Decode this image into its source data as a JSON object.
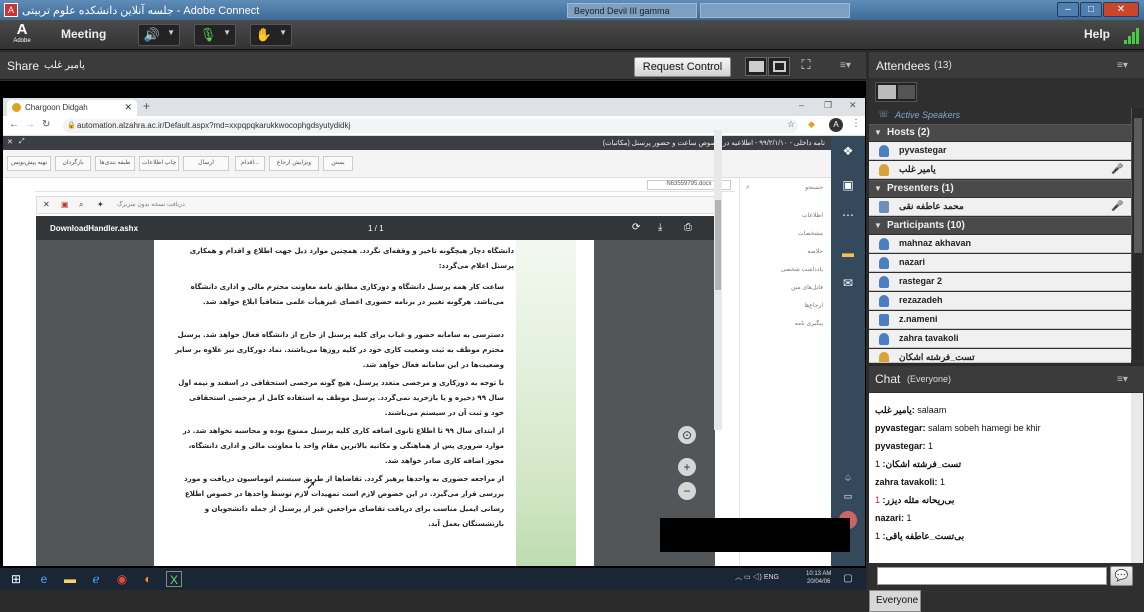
{
  "window": {
    "title": "جلسه آنلاین دانشکده علوم تربیتی - Adobe Connect",
    "app_icon": "adobe-connect-icon",
    "ghost_tab": "Beyond Devil III gamma"
  },
  "menubar": {
    "logo": "Adobe",
    "meeting": "Meeting",
    "help": "Help"
  },
  "share_pod": {
    "title": "Share",
    "presenter": "یامیر غلب",
    "request_control": "Request Control"
  },
  "browser": {
    "tab_title": "Chargoon Didgah",
    "url": "automation.alzahra.ac.ir/Default.aspx?md=xxpqpqkarukkwocophgdsyutydidkj",
    "avatar": "A"
  },
  "webapp": {
    "top_breadcrumb": "نامه داخلی - ۹۹/۲/۱/۱۰ - اطلاعیه در خصوص ساعت و حضور پرسنل (مکاتبات)",
    "toolbar_buttons": [
      "تهیه پیش‌نویس",
      "بازگردان",
      "طبقه بندی‌ها",
      "چاپ اطلاعات",
      "ارسال",
      "اقدام...",
      "ویرایش ارجاع",
      "بستن"
    ],
    "doc_filename": "N63559795.docx",
    "attach_check": "دریافت نسخه بدون سربرگ",
    "search_label": "جستجو",
    "right_nav": [
      "اطلاعات",
      "مشخصات",
      "خلاصه",
      "یادداشت شخصی",
      "فایل‌های متن",
      "ارجاع‌ها",
      "پیگیری نامه"
    ],
    "pdf": {
      "filename": "DownloadHandler.ashx",
      "page_indicator": "1 / 1",
      "intro": "دانشگاه دچار هیچگونه تاخیر و وقفه‌ای نگردد. همچنین موارد ذیل جهت اطلاع و اقدام و همکاری پرسنل اعلام می‌گردد:",
      "bullets": [
        "ساعت کار همه پرسنل دانشگاه و دورکاری مطابق نامه معاونت محترم مالی و اداری دانشگاه می‌باشد. هرگونه تغییر در برنامه حضوری اعضای غیرهیأت علمی متعاقباً ابلاغ خواهد شد.",
        "دسترسی به سامانه حضور و غیاب برای کلیه پرسنل از خارج از دانشگاه فعال خواهد شد. پرسنل محترم موظف به ثبت وضعیت کاری خود در کلیه روزها می‌باشند. نماد دورکاری نیز علاوه بر سایر وضعیت‌ها در این سامانه فعال خواهد شد.",
        "با توجه به دورکاری و مرخصی متعدد پرسنل، هیچ گونه مرخصی استحقاقی در اسفند و نیمه اول سال ۹۹ ذخیره و یا بازخرید نمی‌گردد. پرسنل موظف به استفاده کامل از مرخصی استحقاقی خود و ثبت آن در سیستم می‌باشند.",
        "از ابتدای سال ۹۹ تا اطلاع ثانوی اضافه کاری کلیه پرسنل ممنوع بوده و محاسبه نخواهد شد. در موارد ضروری پس از هماهنگی و مکاتبه بالاترین مقام واحد با معاونت مالی و اداری دانشگاه، مجوز اضافه کاری صادر خواهد شد.",
        "از مراجعه حضوری به واحدها پرهیز گردد. تقاضاها از طریق سیستم اتوماسیون دریافت و مورد بررسی قرار می‌گیرد. در این خصوص لازم است تمهیدات لازم توسط واحدها در خصوص اطلاع رسانی ایمیل مناسب برای دریافت تقاضای مراجعین غیر از پرسنل از جمله دانشجویان و بازنشستگان بعمل آید."
      ]
    }
  },
  "taskbar": {
    "lang": "ENG",
    "time": "10:13 AM",
    "date": "20/04/06"
  },
  "attendees": {
    "title": "Attendees",
    "count": "(13)",
    "active_speakers": "Active Speakers",
    "hosts_label": "Hosts (2)",
    "hosts": [
      "pyvastegar",
      "یامیر غلب"
    ],
    "presenters_label": "Presenters (1)",
    "presenters": [
      "محمد عاطفه نقی"
    ],
    "participants_label": "Participants (10)",
    "participants": [
      "mahnaz akhavan",
      "nazari",
      "rastegar 2",
      "rezazadeh",
      "z.nameni",
      "zahra tavakoli",
      "تست_فرشته اشکان"
    ]
  },
  "chat": {
    "title": "Chat",
    "scope": "(Everyone)",
    "messages": [
      {
        "sender": "یامیر غلب",
        "text": "salaam"
      },
      {
        "sender": "pyvastegar",
        "text": "salam sobeh hamegi be khir"
      },
      {
        "sender": "pyvastegar",
        "text": "1"
      },
      {
        "sender": "تست_فرشته اشکان",
        "text": "1"
      },
      {
        "sender": "zahra tavakoli",
        "text": "1"
      },
      {
        "sender": "بی‌ریحانه مثله دیزر",
        "text": "1"
      },
      {
        "sender": "nazari",
        "text": "1"
      },
      {
        "sender": "بی‌تست_عاطفه یاقی",
        "text": "1"
      }
    ],
    "tab_label": "Everyone"
  }
}
